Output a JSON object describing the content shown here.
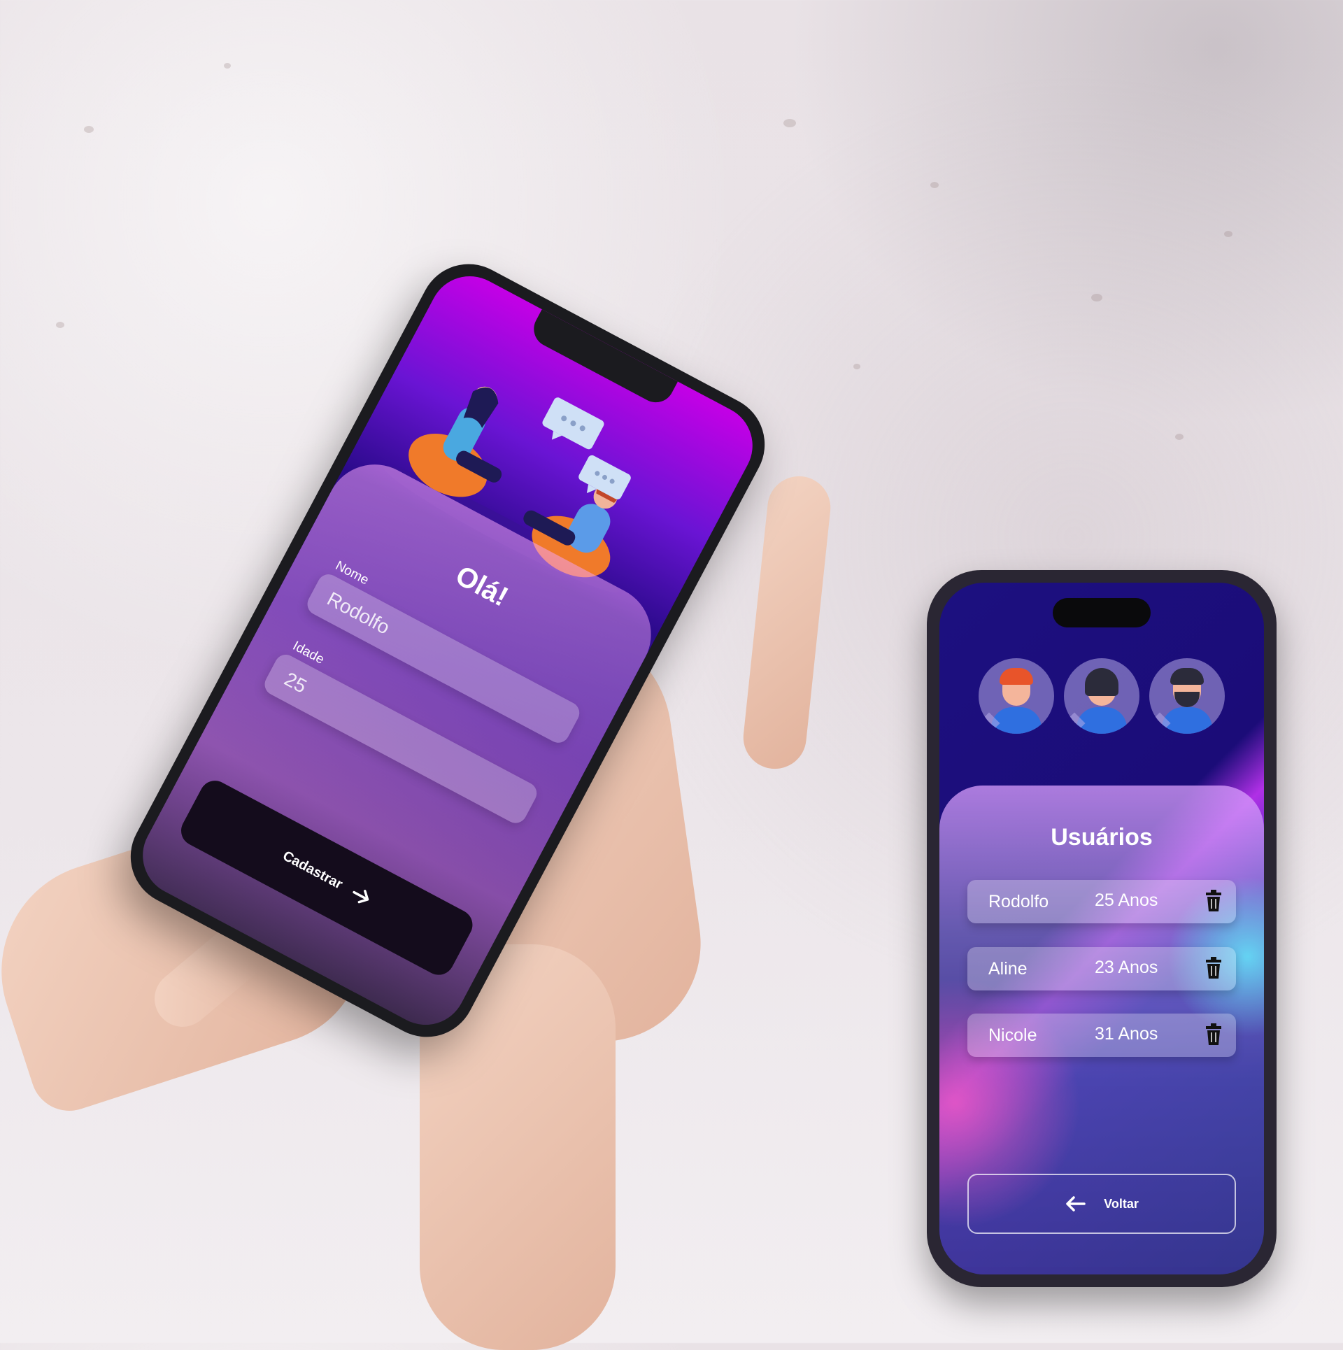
{
  "register_screen": {
    "title": "Olá!",
    "name_label": "Nome",
    "name_value": "Rodolfo",
    "age_label": "Idade",
    "age_value": "25",
    "submit_label": "Cadastrar",
    "icons": {
      "submit": "arrow-right-icon",
      "illustration": "people-chatting-illustration"
    }
  },
  "users_screen": {
    "title": "Usuários",
    "users": [
      {
        "name": "Rodolfo",
        "age": "25 Anos"
      },
      {
        "name": "Aline",
        "age": "23 Anos"
      },
      {
        "name": "Nicole",
        "age": "31 Anos"
      }
    ],
    "back_label": "Voltar",
    "icons": {
      "delete": "trash-icon",
      "back": "arrow-left-icon",
      "avatars": [
        "avatar-man-icon",
        "avatar-woman-icon",
        "avatar-bearded-man-icon"
      ]
    }
  },
  "colors": {
    "accent_magenta": "#c400e6",
    "deep_indigo": "#2a0a8a",
    "button_dark": "#140c1c",
    "cyan_glow": "#64f0ff",
    "pink_glow": "#ff5ac8"
  }
}
